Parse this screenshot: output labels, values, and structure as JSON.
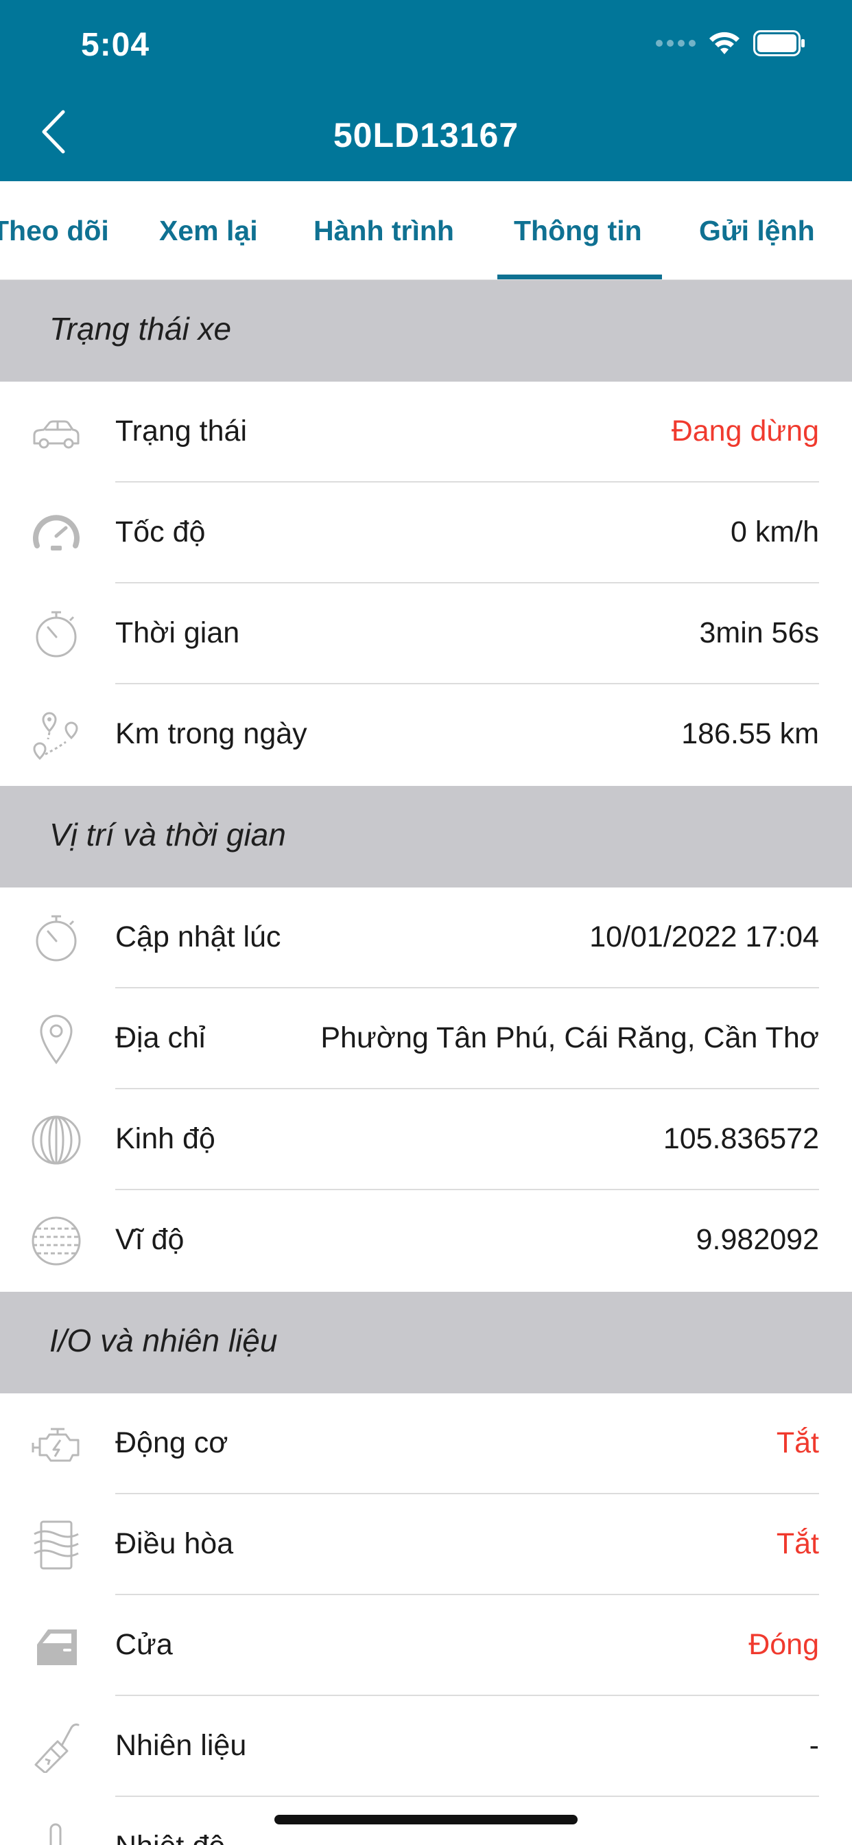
{
  "status_bar": {
    "time": "5:04"
  },
  "header": {
    "title": "50LD13167"
  },
  "tabs": [
    {
      "label": "Theo dõi"
    },
    {
      "label": "Xem lại"
    },
    {
      "label": "Hành trình"
    },
    {
      "label": "Thông tin",
      "active": true
    },
    {
      "label": "Gửi lệnh"
    }
  ],
  "sections": {
    "vehicle_status": {
      "title": "Trạng thái xe",
      "rows": [
        {
          "icon": "car-icon",
          "label": "Trạng thái",
          "value": "Đang dừng"
        },
        {
          "icon": "speedometer-icon",
          "label": "Tốc độ",
          "value": "0 km/h"
        },
        {
          "icon": "stopwatch-icon",
          "label": "Thời gian",
          "value": "3min 56s"
        },
        {
          "icon": "route-icon",
          "label": "Km trong ngày",
          "value": "186.55 km"
        }
      ]
    },
    "position_time": {
      "title": "Vị trí và thời gian",
      "rows": [
        {
          "icon": "stopwatch-icon",
          "label": "Cập nhật lúc",
          "value": "10/01/2022 17:04"
        },
        {
          "icon": "location-pin-icon",
          "label": "Địa chỉ",
          "value": "Phường Tân Phú, Cái Răng, Cần Thơ"
        },
        {
          "icon": "longitude-globe-icon",
          "label": "Kinh độ",
          "value": "105.836572"
        },
        {
          "icon": "latitude-globe-icon",
          "label": "Vĩ độ",
          "value": "9.982092"
        }
      ]
    },
    "io_fuel": {
      "title": "I/O và nhiên liệu",
      "rows": [
        {
          "icon": "engine-icon",
          "label": "Động cơ",
          "value": "Tắt"
        },
        {
          "icon": "air-conditioner-icon",
          "label": "Điều hòa",
          "value": "Tắt"
        },
        {
          "icon": "car-door-icon",
          "label": "Cửa",
          "value": "Đóng"
        },
        {
          "icon": "fuel-nozzle-icon",
          "label": "Nhiên liệu",
          "value": "-"
        },
        {
          "icon": "thermometer-icon",
          "label": "Nhiệt độ",
          "value": ""
        }
      ]
    }
  },
  "colors": {
    "header": "#017699",
    "accent": "#0f7192",
    "section_bg": "#c8c8cc",
    "alert": "#f03a2e"
  }
}
